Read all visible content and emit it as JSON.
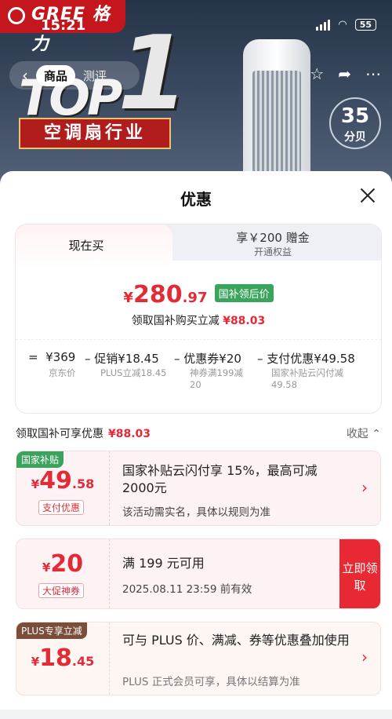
{
  "status_bar": {
    "time": "15:21",
    "battery": "55"
  },
  "background": {
    "brand": "GREE 格力",
    "top_label": "TOP",
    "top_number": "1",
    "banner": "空调扇行业",
    "db_value": "35",
    "db_unit": "分贝"
  },
  "nav": {
    "tabs": [
      {
        "label": "商品"
      },
      {
        "label": "测评"
      }
    ]
  },
  "sheet": {
    "title": "优惠"
  },
  "calc": {
    "tab_now": "现在买",
    "tab_plus_line1": "享￥200 赠金",
    "tab_plus_line2": "开通权益",
    "final_currency": "¥",
    "final_int": "280",
    "final_dec": ".97",
    "final_tag": "国补领后价",
    "sub_text": "领取国补购买立减",
    "sub_amount": "¥88.03",
    "breakdown": [
      {
        "op": "=",
        "value": "¥369",
        "label": "京东价"
      },
      {
        "op": "–",
        "value": "促销¥18.45",
        "label": "PLUS立减18.45"
      },
      {
        "op": "–",
        "value": "优惠券¥20",
        "label": "神券满199减20"
      },
      {
        "op": "–",
        "value": "支付优惠¥49.58",
        "label": "国家补贴云闪付减49.58"
      }
    ]
  },
  "section": {
    "title": "领取国补可享优惠",
    "amount": "¥88.03",
    "collapse": "收起"
  },
  "cards": [
    {
      "ribbon": "国家补贴",
      "currency": "¥",
      "int": "49",
      "dec": ".58",
      "badge": "支付优惠",
      "title": "国家补贴云闪付享 15%，最高可减 2000元",
      "desc": "该活动需实名，具体以规则为准"
    },
    {
      "currency": "¥",
      "int": "20",
      "dec": "",
      "badge": "大促神券",
      "title": "满 199 元可用",
      "desc": "2025.08.11 23:59 前有效",
      "action": "立即领取"
    },
    {
      "ribbon": "PLUS专享立减",
      "currency": "¥",
      "int": "18",
      "dec": ".45",
      "title": "可与 PLUS 价、满减、券等优惠叠加使用",
      "desc": "PLUS 正式会员可享，具体以结算为准"
    }
  ],
  "colors": {
    "accent": "#e22b36",
    "green_tag": "#3aa35c",
    "plus_brown": "#7a4e3a"
  }
}
